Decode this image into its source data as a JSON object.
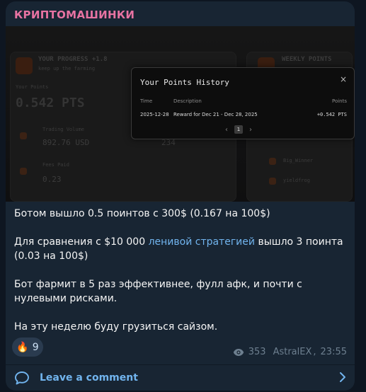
{
  "post": {
    "channel_name": "КРИПТОМАШИНКИ"
  },
  "screenshot": {
    "background": {
      "progress_title": "YOUR PROGRESS +1.8",
      "progress_sub": "keep up the farming",
      "your_points_label": "Your Points",
      "your_points_value": "0.542 PTS",
      "trading_volume_label": "Trading Volume",
      "trading_volume_value": "892.76 USD",
      "fees_label": "Fees Paid",
      "fees_value": "0.23",
      "weekly_title": "WEEKLY POINTS",
      "rank_value": "234",
      "leader1": "Big_Winner",
      "leader2": "yieldfrog"
    },
    "modal": {
      "title": "Your Points History",
      "close_symbol": "×",
      "columns": [
        "Time",
        "Description",
        "Points"
      ],
      "rows": [
        {
          "time": "2025-12-28",
          "description": "Reward for Dec 21 - Dec 28, 2025",
          "points": "+0.542 PTS"
        }
      ],
      "pager": {
        "prev": "‹",
        "page": "1",
        "next": "›"
      }
    }
  },
  "message": {
    "p1": "Ботом вышло 0.5 поинтов с 300$ (0.167 на 100$)",
    "p2_before": "Для сравнения с $10 000 ",
    "p2_link": "ленивой стратегией",
    "p2_after": " вышло 3 поинта (0.03 на 100$)",
    "p3": "Бот фармит в 5 раз эффективнее, фулл афк, и почти с нулевыми рисками.",
    "p4": "На эту неделю буду грузиться сайзом."
  },
  "reaction": {
    "emoji": "🔥",
    "count": "9"
  },
  "meta": {
    "views": "353",
    "author": "AstralEX",
    "time": "23:55"
  },
  "comments": {
    "label": "Leave a comment"
  },
  "colors": {
    "accent": "#71b4ee",
    "channel": "#e773a2",
    "bubble": "#182533"
  }
}
